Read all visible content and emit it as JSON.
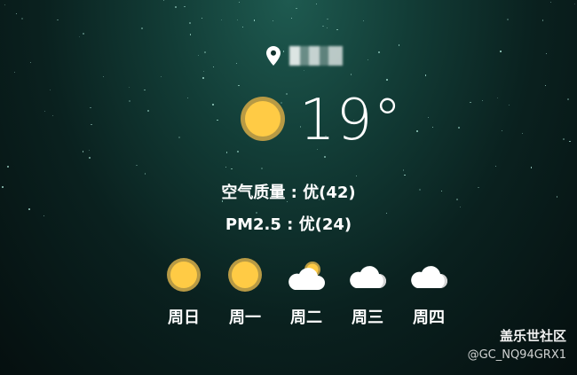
{
  "location": {
    "name": "",
    "pin_icon": "location-pin-icon"
  },
  "current": {
    "temperature": "19°",
    "icon": "sun-icon"
  },
  "air_quality": {
    "line1": "空气质量 : 优(42)",
    "line2": "PM2.5 : 优(24)"
  },
  "forecast": [
    {
      "day": "周日",
      "icon": "sun-icon"
    },
    {
      "day": "周一",
      "icon": "sun-icon"
    },
    {
      "day": "周二",
      "icon": "partly-cloudy-icon"
    },
    {
      "day": "周三",
      "icon": "cloud-icon"
    },
    {
      "day": "周四",
      "icon": "cloud-icon"
    }
  ],
  "watermark": {
    "title": "盖乐世社区",
    "user": "@GC_NQ94GRX1"
  },
  "colors": {
    "sun": "#ffcb45",
    "sun_ring": "#b89a44",
    "cloud": "#ffffff",
    "background": "#0a211f"
  }
}
